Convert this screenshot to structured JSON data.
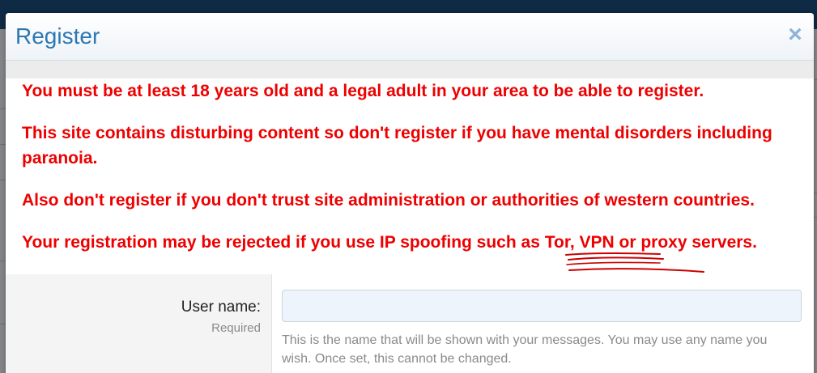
{
  "dialog": {
    "title": "Register",
    "close_icon": "close-icon",
    "close_glyph": "×"
  },
  "notice": {
    "line1": "You must be at least 18 years old and a legal adult in your area to be able to register.",
    "line2": "This site contains disturbing content so don't register if you have mental disorders including paranoia.",
    "line3": "Also don't register if you don't trust site administration or authorities of western countries.",
    "line4": "Your registration may be rejected if you use IP spoofing such as Tor, VPN or proxy servers.",
    "color": "#ee0000"
  },
  "form": {
    "username": {
      "label": "User name:",
      "hint": "Required",
      "value": "",
      "explain": "This is the name that will be shown with your messages. You may use any name you wish. Once set, this cannot be changed."
    }
  },
  "colors": {
    "title": "#2c77b3",
    "close": "#8fb3d6",
    "annotation": "#cc0000"
  }
}
